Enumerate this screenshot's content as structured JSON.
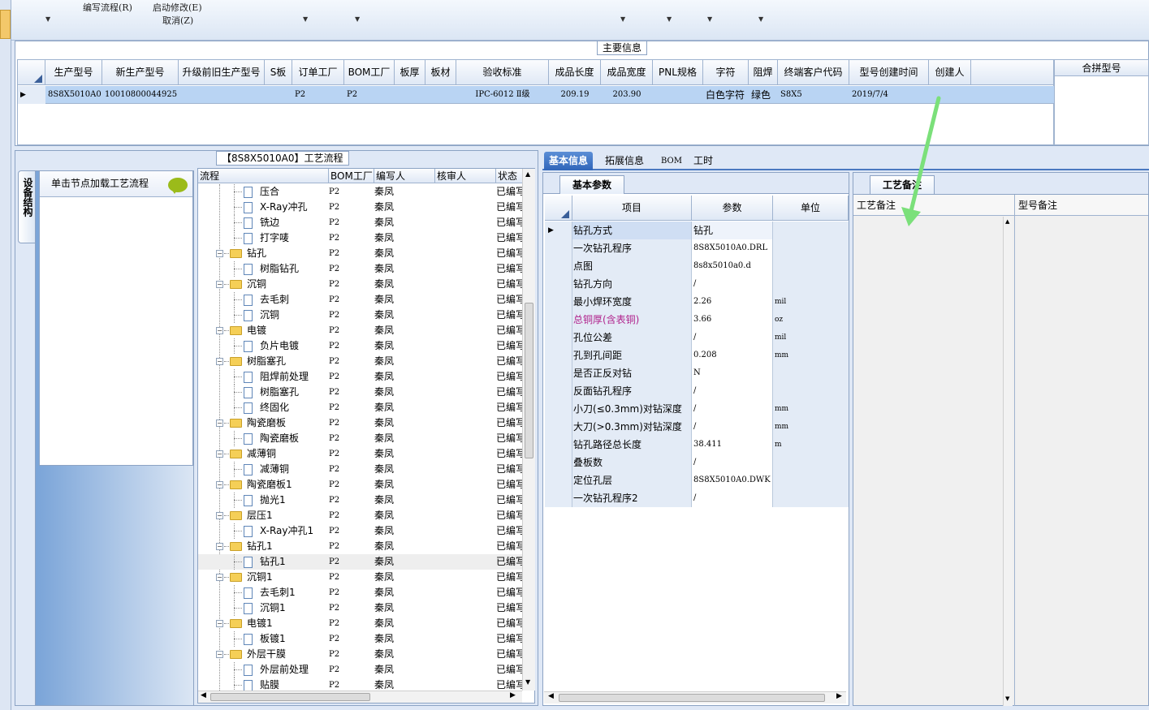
{
  "menu": {
    "items": [
      "编写流程(R)",
      "启动修改(E)",
      "取消(Z)"
    ]
  },
  "main_info": {
    "legend": "主要信息",
    "columns": [
      "生产型号",
      "新生产型号",
      "升级前旧生产型号",
      "S板",
      "订单工厂",
      "BOM工厂",
      "板厚",
      "板材",
      "验收标准",
      "成品长度",
      "成品宽度",
      "PNL规格",
      "字符",
      "阻焊",
      "终端客户代码",
      "型号创建时间",
      "创建人"
    ],
    "row": [
      "8S8X5010A0",
      "10010800044925",
      "",
      "",
      "P2",
      "P2",
      "",
      "",
      "IPC-6012 Ⅱ级",
      "209.19",
      "203.90",
      "",
      "白色字符",
      "绿色",
      "S8X5",
      "2019/7/4",
      ""
    ],
    "merge_header": "合拼型号"
  },
  "flow": {
    "legend": "【8S8X5010A0】工艺流程",
    "side_tab": "设备结构",
    "load_hint": "单击节点加载工艺流程",
    "columns": [
      "流程",
      "BOM工厂",
      "编写人",
      "核审人",
      "状态"
    ],
    "rows": [
      {
        "name": "压合",
        "level": 2,
        "bom": "P2",
        "writer": "秦凤",
        "status": "已编写"
      },
      {
        "name": "X-Ray冲孔",
        "level": 2,
        "bom": "P2",
        "writer": "秦凤",
        "status": "已编写"
      },
      {
        "name": "铣边",
        "level": 2,
        "bom": "P2",
        "writer": "秦凤",
        "status": "已编写"
      },
      {
        "name": "打字唛",
        "level": 2,
        "bom": "P2",
        "writer": "秦凤",
        "status": "已编写"
      },
      {
        "name": "钻孔",
        "level": 1,
        "bom": "P2",
        "writer": "秦凤",
        "status": "已编写"
      },
      {
        "name": "树脂钻孔",
        "level": 2,
        "bom": "P2",
        "writer": "秦凤",
        "status": "已编写"
      },
      {
        "name": "沉铜",
        "level": 1,
        "bom": "P2",
        "writer": "秦凤",
        "status": "已编写"
      },
      {
        "name": "去毛刺",
        "level": 2,
        "bom": "P2",
        "writer": "秦凤",
        "status": "已编写"
      },
      {
        "name": "沉铜",
        "level": 2,
        "bom": "P2",
        "writer": "秦凤",
        "status": "已编写"
      },
      {
        "name": "电镀",
        "level": 1,
        "bom": "P2",
        "writer": "秦凤",
        "status": "已编写"
      },
      {
        "name": "负片电镀",
        "level": 2,
        "bom": "P2",
        "writer": "秦凤",
        "status": "已编写"
      },
      {
        "name": "树脂塞孔",
        "level": 1,
        "bom": "P2",
        "writer": "秦凤",
        "status": "已编写"
      },
      {
        "name": "阻焊前处理",
        "level": 2,
        "bom": "P2",
        "writer": "秦凤",
        "status": "已编写"
      },
      {
        "name": "树脂塞孔",
        "level": 2,
        "bom": "P2",
        "writer": "秦凤",
        "status": "已编写"
      },
      {
        "name": "终固化",
        "level": 2,
        "bom": "P2",
        "writer": "秦凤",
        "status": "已编写"
      },
      {
        "name": "陶瓷磨板",
        "level": 1,
        "bom": "P2",
        "writer": "秦凤",
        "status": "已编写"
      },
      {
        "name": "陶瓷磨板",
        "level": 2,
        "bom": "P2",
        "writer": "秦凤",
        "status": "已编写"
      },
      {
        "name": "减薄铜",
        "level": 1,
        "bom": "P2",
        "writer": "秦凤",
        "status": "已编写"
      },
      {
        "name": "减薄铜",
        "level": 2,
        "bom": "P2",
        "writer": "秦凤",
        "status": "已编写"
      },
      {
        "name": "陶瓷磨板1",
        "level": 1,
        "bom": "P2",
        "writer": "秦凤",
        "status": "已编写"
      },
      {
        "name": "抛光1",
        "level": 2,
        "bom": "P2",
        "writer": "秦凤",
        "status": "已编写"
      },
      {
        "name": "层压1",
        "level": 1,
        "bom": "P2",
        "writer": "秦凤",
        "status": "已编写"
      },
      {
        "name": "X-Ray冲孔1",
        "level": 2,
        "bom": "P2",
        "writer": "秦凤",
        "status": "已编写"
      },
      {
        "name": "钻孔1",
        "level": 1,
        "bom": "P2",
        "writer": "秦凤",
        "status": "已编写"
      },
      {
        "name": "钻孔1",
        "level": 2,
        "bom": "P2",
        "writer": "秦凤",
        "status": "已编写",
        "selected": true
      },
      {
        "name": "沉铜1",
        "level": 1,
        "bom": "P2",
        "writer": "秦凤",
        "status": "已编写"
      },
      {
        "name": "去毛刺1",
        "level": 2,
        "bom": "P2",
        "writer": "秦凤",
        "status": "已编写"
      },
      {
        "name": "沉铜1",
        "level": 2,
        "bom": "P2",
        "writer": "秦凤",
        "status": "已编写"
      },
      {
        "name": "电镀1",
        "level": 1,
        "bom": "P2",
        "writer": "秦凤",
        "status": "已编写"
      },
      {
        "name": "板镀1",
        "level": 2,
        "bom": "P2",
        "writer": "秦凤",
        "status": "已编写"
      },
      {
        "name": "外层干膜",
        "level": 1,
        "bom": "P2",
        "writer": "秦凤",
        "status": "已编写"
      },
      {
        "name": "外层前处理",
        "level": 2,
        "bom": "P2",
        "writer": "秦凤",
        "status": "已编写"
      },
      {
        "name": "贴膜",
        "level": 2,
        "bom": "P2",
        "writer": "秦凤",
        "status": "已编写"
      }
    ]
  },
  "detail": {
    "tabs": [
      "基本信息",
      "拓展信息",
      "BOM",
      "工时"
    ],
    "subtab": "基本参数",
    "columns": [
      "项目",
      "参数",
      "单位"
    ],
    "rows": [
      {
        "item": "钻孔方式",
        "param": "钻孔",
        "unit": ""
      },
      {
        "item": "一次钻孔程序",
        "param": "8S8X5010A0.DRL",
        "unit": ""
      },
      {
        "item": "点图",
        "param": "8s8x5010a0.d",
        "unit": ""
      },
      {
        "item": "钻孔方向",
        "param": "/",
        "unit": ""
      },
      {
        "item": "最小焊环宽度",
        "param": "2.26",
        "unit": "mil"
      },
      {
        "item": "总铜厚(含表铜)",
        "param": "3.66",
        "unit": "oz",
        "accent": "#b0228c"
      },
      {
        "item": "孔位公差",
        "param": "/",
        "unit": "mil"
      },
      {
        "item": "孔到孔间距",
        "param": "0.208",
        "unit": "mm"
      },
      {
        "item": "是否正反对钻",
        "param": "N",
        "unit": ""
      },
      {
        "item": "反面钻孔程序",
        "param": "/",
        "unit": ""
      },
      {
        "item": "小刀(≤0.3mm)对钻深度",
        "param": "/",
        "unit": "mm"
      },
      {
        "item": "大刀(>0.3mm)对钻深度",
        "param": "/",
        "unit": "mm"
      },
      {
        "item": "钻孔路径总长度",
        "param": "38.411",
        "unit": "m"
      },
      {
        "item": "叠板数",
        "param": "/",
        "unit": ""
      },
      {
        "item": "定位孔层",
        "param": "8S8X5010A0.DWK",
        "unit": ""
      },
      {
        "item": "一次钻孔程序2",
        "param": "/",
        "unit": ""
      }
    ]
  },
  "notes": {
    "tab": "工艺备注",
    "process_note": "工艺备注",
    "model_note": "型号备注"
  },
  "colors": {
    "accent": "#2f65b9",
    "selected_row": "#b9d4f3",
    "arrow": "#7be07a"
  }
}
